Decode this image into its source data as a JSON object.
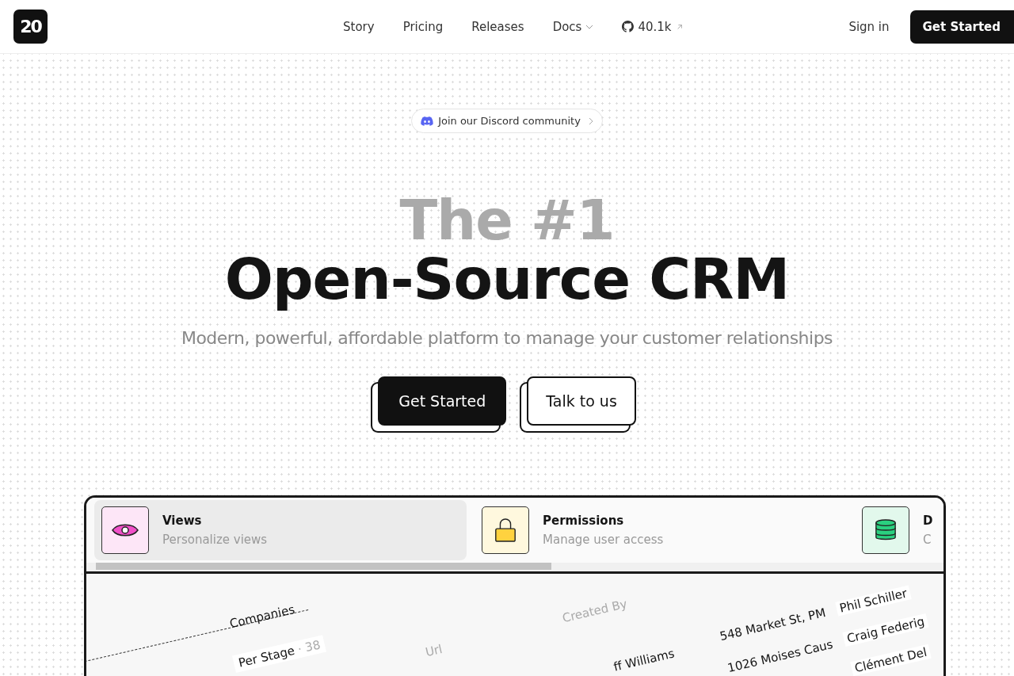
{
  "nav": {
    "logo": "20",
    "links": [
      {
        "label": "Story",
        "kind": "plain"
      },
      {
        "label": "Pricing",
        "kind": "plain"
      },
      {
        "label": "Releases",
        "kind": "plain"
      },
      {
        "label": "Docs",
        "kind": "dropdown"
      },
      {
        "label": "40.1k",
        "kind": "github"
      }
    ],
    "sign_in": "Sign in",
    "cta": "Get Started"
  },
  "hero": {
    "badge": "Join our Discord community",
    "title_line_1": "The #1",
    "title_line_2": "Open-Source CRM",
    "subtitle": "Modern, powerful, affordable platform to manage your customer relationships",
    "primary": "Get Started",
    "secondary": "Talk to us"
  },
  "features": [
    {
      "kind": "eye",
      "title": "Views",
      "desc": "Personalize views",
      "selected": true
    },
    {
      "kind": "lock",
      "title": "Permissions",
      "desc": "Manage user access",
      "selected": false
    },
    {
      "kind": "database",
      "title": "D",
      "desc": "C",
      "selected": false
    }
  ],
  "preview": {
    "object": "Companies",
    "view": "Per Stage",
    "count": "· 38",
    "columns": [
      "Url",
      "Created By"
    ],
    "cells": [
      "ff Williams",
      "548 Market St, PM",
      "1026 Moises Caus"
    ],
    "people": [
      "Phil Schiller",
      "Craig Federig",
      "Clément Del"
    ]
  }
}
